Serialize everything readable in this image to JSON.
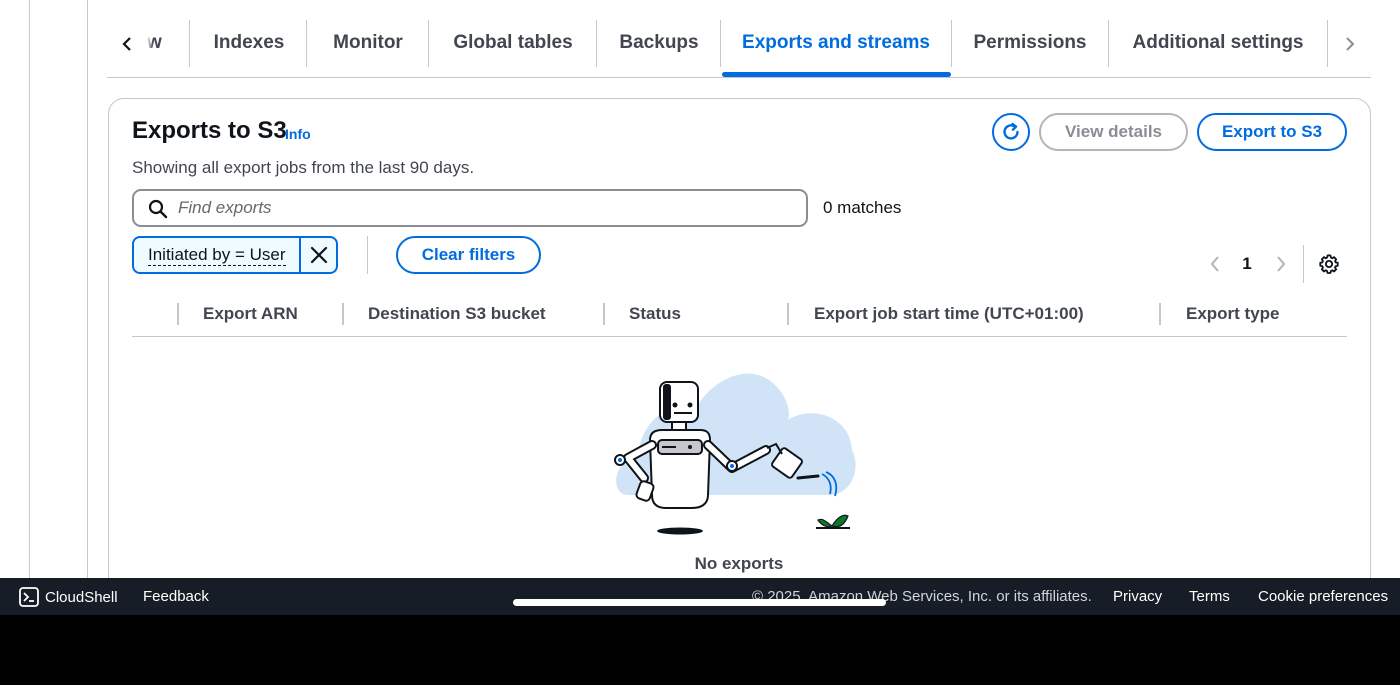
{
  "tabs": {
    "items": [
      {
        "label": "w"
      },
      {
        "label": "Indexes"
      },
      {
        "label": "Monitor"
      },
      {
        "label": "Global tables"
      },
      {
        "label": "Backups"
      },
      {
        "label": "Exports and streams"
      },
      {
        "label": "Permissions"
      },
      {
        "label": "Additional settings"
      }
    ],
    "active": "Exports and streams"
  },
  "exports": {
    "title": "Exports to S3",
    "info_link": "Info",
    "description": "Showing all export jobs from the last 90 days.",
    "refresh_icon": "refresh-icon",
    "view_details": "View details",
    "export_button": "Export to S3",
    "search_placeholder": "Find exports",
    "search_value": "",
    "matches": "0 matches",
    "filter_token": "Initiated by = User",
    "clear_filters": "Clear filters",
    "page_number": "1",
    "columns": [
      "Export ARN",
      "Destination S3 bucket",
      "Status",
      "Export job start time (UTC+01:00)",
      "Export type"
    ],
    "empty_text": "No exports"
  },
  "footer": {
    "cloudshell": "CloudShell",
    "feedback": "Feedback",
    "copyright": "© 2025, Amazon Web Services, Inc. or its affiliates.",
    "privacy": "Privacy",
    "terms": "Terms",
    "cookie": "Cookie preferences"
  },
  "colors": {
    "accent": "#006ce0",
    "footer_bg": "#161d26",
    "border": "#c6c6cd"
  }
}
